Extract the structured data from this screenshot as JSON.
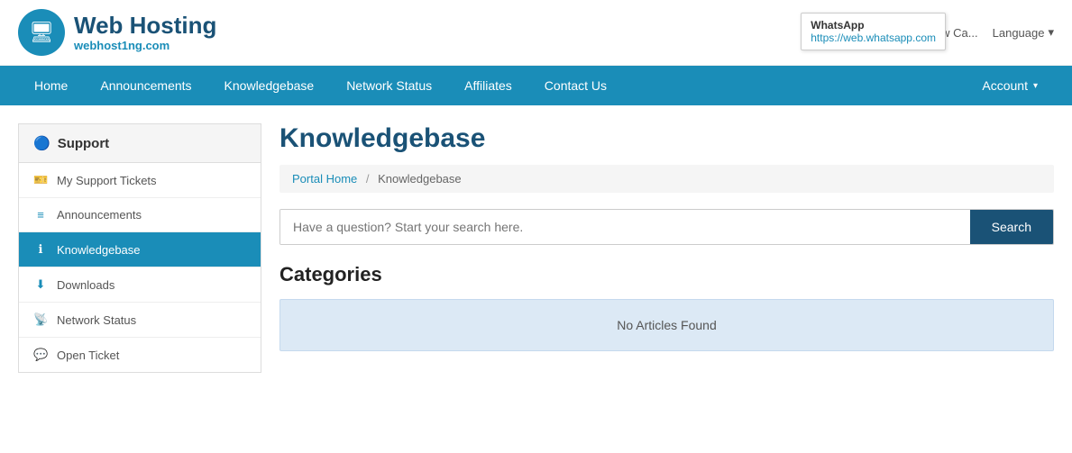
{
  "header": {
    "logo_title": "Web Hosting",
    "logo_subtitle": "webhost1ng.com",
    "cart_text": "View Ca...",
    "language_text": "Language"
  },
  "tooltip": {
    "title": "WhatsApp",
    "url": "https://web.whatsapp.com"
  },
  "nav": {
    "items": [
      {
        "label": "Home",
        "id": "home"
      },
      {
        "label": "Announcements",
        "id": "announcements"
      },
      {
        "label": "Knowledgebase",
        "id": "knowledgebase"
      },
      {
        "label": "Network Status",
        "id": "network-status"
      },
      {
        "label": "Affiliates",
        "id": "affiliates"
      },
      {
        "label": "Contact Us",
        "id": "contact"
      }
    ],
    "account_label": "Account"
  },
  "sidebar": {
    "header_label": "Support",
    "items": [
      {
        "label": "My Support Tickets",
        "id": "tickets",
        "icon": "🎫",
        "active": false
      },
      {
        "label": "Announcements",
        "id": "announcements",
        "icon": "≡",
        "active": false
      },
      {
        "label": "Knowledgebase",
        "id": "knowledgebase",
        "icon": "ℹ",
        "active": true
      },
      {
        "label": "Downloads",
        "id": "downloads",
        "icon": "⬇",
        "active": false
      },
      {
        "label": "Network Status",
        "id": "network-status",
        "icon": "📡",
        "active": false
      },
      {
        "label": "Open Ticket",
        "id": "open-ticket",
        "icon": "💬",
        "active": false
      }
    ]
  },
  "main": {
    "page_title": "Knowledgebase",
    "breadcrumb": {
      "home_label": "Portal Home",
      "current_label": "Knowledgebase"
    },
    "search": {
      "placeholder": "Have a question? Start your search here.",
      "button_label": "Search"
    },
    "categories_title": "Categories",
    "no_articles_text": "No Articles Found"
  }
}
